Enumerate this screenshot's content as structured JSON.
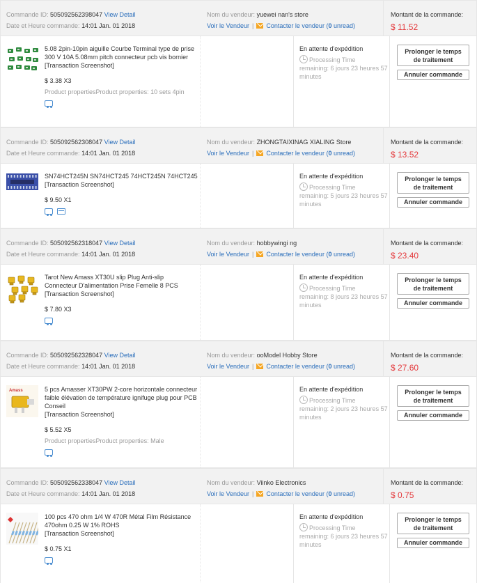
{
  "labels": {
    "order_id": "Commande ID:",
    "view_detail": "View Detail",
    "order_datetime": "Date et Heure commande:",
    "seller_name": "Nom du vendeur:",
    "view_seller": "Voir le Vendeur",
    "separator": "|",
    "contact_seller": "Contacter le vendeur",
    "order_amount": "Montant de la commande:",
    "snapshot": "[Transaction Screenshot]",
    "status": "En attente d'expédition",
    "processing_time": "Processing Time",
    "extend_button": "Prolonger le temps de traitement",
    "cancel_button": "Annuler commande"
  },
  "orders": [
    {
      "id": "505092562398047",
      "datetime": "14:01 Jan. 01 2018",
      "seller": "yuewei nan's store",
      "unread_open": "(",
      "unread_count": "0",
      "unread_close": " unread)",
      "amount": "$ 11.52",
      "product": "5.08 2pin-10pin aiguille Courbe Terminal type de prise 300 V 10A 5.08mm pitch connecteur pcb vis bornier",
      "price_qty": "$ 3.38 X3",
      "properties": "Product propertiesProduct properties: 10 sets 4pin",
      "remaining": "remaining: 6 jours 23 heures 57 minutes",
      "thumb": "green-terminal-blocks",
      "icons": [
        "truck-icon"
      ]
    },
    {
      "id": "505092562308047",
      "datetime": "14:01 Jan. 01 2018",
      "seller": "ZHONGTAIXINAG XIALING Store",
      "unread_open": "(",
      "unread_count": "0",
      "unread_close": " unread)",
      "amount": "$ 13.52",
      "product": "SN74HCT245N SN74HCT245 74HCT245N 74HCT245",
      "price_qty": "$ 9.50 X1",
      "properties": "",
      "remaining": "remaining: 5 jours 23 heures 57 minutes",
      "thumb": "blue-ic-chip",
      "icons": [
        "truck-icon",
        "card-icon"
      ]
    },
    {
      "id": "505092562318047",
      "datetime": "14:01 Jan. 01 2018",
      "seller": "hobbywingi ng",
      "unread_open": "(",
      "unread_count": "0",
      "unread_close": " unread)",
      "amount": "$ 23.40",
      "product": "Tarot New Amass XT30U slip Plug Anti-slip Connecteur D'alimentation Prise Femelle 8 PCS",
      "price_qty": "$ 7.80 X3",
      "properties": "",
      "remaining": "remaining: 8 jours 23 heures 57 minutes",
      "thumb": "yellow-connectors",
      "icons": [
        "truck-icon"
      ]
    },
    {
      "id": "505092562328047",
      "datetime": "14:01 Jan. 01 2018",
      "seller": "ooModel Hobby Store",
      "unread_open": "(",
      "unread_count": "0",
      "unread_close": " unread)",
      "amount": "$ 27.60",
      "product": "5 pcs Amasser XT30PW 2-core horizontale connecteur faible élévation de température ignifuge plug pour PCB Conseil",
      "price_qty": "$ 5.52 X5",
      "properties": "Product propertiesProduct properties: Male",
      "remaining": "remaining: 2 jours 23 heures 57 minutes",
      "thumb": "amass-connector",
      "icons": [
        "truck-icon"
      ]
    },
    {
      "id": "505092562338047",
      "datetime": "14:01 Jan. 01 2018",
      "seller": "Viinko Electronics",
      "unread_open": "(",
      "unread_count": "0",
      "unread_close": " unread)",
      "amount": "$ 0.75",
      "product": "100 pcs 470 ohm 1/4 W 470R Métal Film Résistance 470ohm 0.25 W 1% ROHS",
      "price_qty": "$ 0.75 X1",
      "properties": "",
      "remaining": "remaining: 6 jours 23 heures 57 minutes",
      "thumb": "resistor-strip",
      "icons": [
        "truck-icon"
      ]
    }
  ],
  "colors": {
    "link": "#2a6ebb",
    "amount": "#e4393c",
    "header_bg": "#f2f2f2",
    "mail_icon": "#f5a623"
  }
}
